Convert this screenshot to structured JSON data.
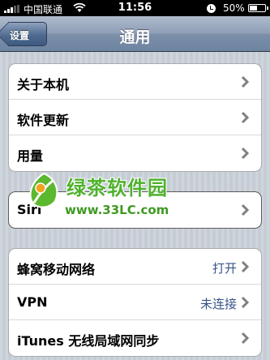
{
  "status_bar": {
    "carrier": "中国联通",
    "time": "11:56",
    "battery_percent": "50%",
    "battery_level": 0.5,
    "icons": [
      "signal-icon",
      "wifi-icon",
      "orientation-lock-icon",
      "battery-icon"
    ]
  },
  "nav": {
    "back_label": "设置",
    "title": "通用"
  },
  "group1": {
    "rows": [
      {
        "label": "关于本机"
      },
      {
        "label": "软件更新"
      },
      {
        "label": "用量"
      }
    ]
  },
  "group2": {
    "rows": [
      {
        "label": "Siri"
      }
    ]
  },
  "group3": {
    "rows": [
      {
        "label": "蜂窝移动网络",
        "value": "打开"
      },
      {
        "label": "VPN",
        "value": "未连接"
      },
      {
        "label": "iTunes 无线局域网同步"
      }
    ]
  },
  "watermark": {
    "title": "绿茶软件园",
    "url": "www.33LC.com"
  },
  "colors": {
    "nav_bar": "#6d84a2",
    "page_bg": "#c5ccd4",
    "value_text": "#385487",
    "watermark_green": "#4fb22d"
  }
}
